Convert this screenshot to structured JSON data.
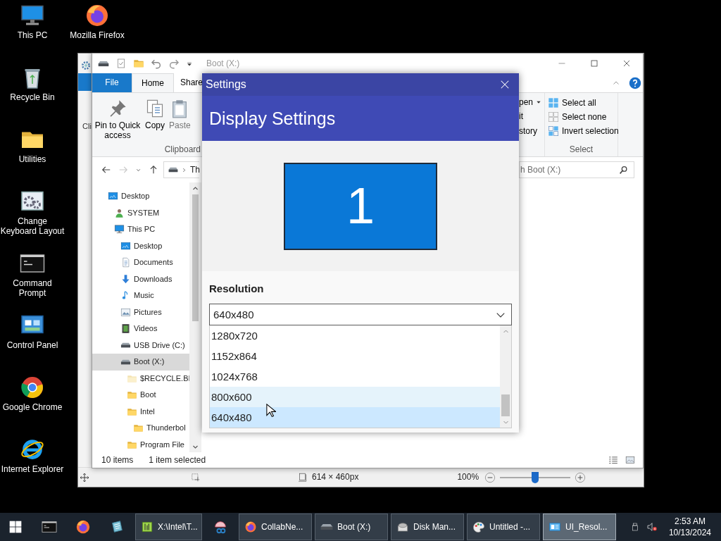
{
  "desktop_icon_columns": [
    [
      {
        "label": "This PC"
      },
      {
        "label": "Recycle Bin"
      },
      {
        "label": "Utilities"
      },
      {
        "label": "Change Keyboard Layout"
      },
      {
        "label": "Command Prompt"
      },
      {
        "label": "Control Panel"
      },
      {
        "label": "Google Chrome"
      },
      {
        "label": "Internet Explorer"
      }
    ],
    [
      {
        "label": "Mozilla Firefox"
      }
    ]
  ],
  "background_window": {
    "ribbon_fragment": "Cli",
    "status_bar": {
      "image_size": "614 × 460px",
      "zoom": "100%",
      "zoom_slider": {
        "level": 0.5
      }
    }
  },
  "explorer": {
    "title": "Boot (X:)",
    "ribbon_tabs": [
      {
        "label": "File",
        "selected": false
      },
      {
        "label": "Home",
        "selected": true
      },
      {
        "label": "Share",
        "selected": false
      }
    ],
    "clipboard": {
      "buttons": [
        "Pin to Quick access",
        "Copy",
        "Paste"
      ],
      "group": "Clipboard"
    },
    "open_fragments": [
      "pen",
      "it",
      "story"
    ],
    "select": {
      "buttons": [
        "Select all",
        "Select none",
        "Invert selection"
      ],
      "group": "Select"
    },
    "address": "Th",
    "search": {
      "placeholder": "h Boot (X:)"
    },
    "tree": [
      {
        "label": "Desktop",
        "kind": "desktop",
        "selected": false,
        "children": [
          {
            "label": "SYSTEM",
            "kind": "user",
            "selected": false
          },
          {
            "label": "This PC",
            "kind": "pc",
            "selected": false,
            "children": [
              {
                "label": "Desktop",
                "kind": "desktop",
                "selected": false
              },
              {
                "label": "Documents",
                "kind": "documents",
                "selected": false
              },
              {
                "label": "Downloads",
                "kind": "downloads",
                "selected": false
              },
              {
                "label": "Music",
                "kind": "music",
                "selected": false
              },
              {
                "label": "Pictures",
                "kind": "pictures",
                "selected": false
              },
              {
                "label": "Videos",
                "kind": "videos",
                "selected": false
              },
              {
                "label": "USB Drive (C:)",
                "kind": "drive",
                "selected": false
              },
              {
                "label": "Boot (X:)",
                "kind": "drive",
                "selected": true,
                "children": [
                  {
                    "label": "$RECYCLE.BI",
                    "kind": "hiddenfolder",
                    "selected": false
                  },
                  {
                    "label": "Boot",
                    "kind": "folder",
                    "selected": false
                  },
                  {
                    "label": "Intel",
                    "kind": "folder",
                    "selected": false,
                    "children": [
                      {
                        "label": "Thunderbol",
                        "kind": "folder",
                        "selected": false
                      }
                    ]
                  },
                  {
                    "label": "Program File",
                    "kind": "folder",
                    "selected": false
                  }
                ]
              }
            ]
          }
        ]
      }
    ],
    "status_bar": {
      "count": "10 items",
      "selection": "1 item selected"
    }
  },
  "settings": {
    "title": "Settings",
    "heading": "Display Settings",
    "monitor": "1",
    "resolution_label": "Resolution",
    "resolution": {
      "value": "640x480",
      "expanded": true,
      "options": [
        {
          "label": "1280x720",
          "selected": false,
          "hovered": false
        },
        {
          "label": "1152x864",
          "selected": false,
          "hovered": false
        },
        {
          "label": "1024x768",
          "selected": false,
          "hovered": false
        },
        {
          "label": "800x600",
          "selected": false,
          "hovered": true
        },
        {
          "label": "640x480",
          "selected": true,
          "hovered": false
        }
      ]
    }
  },
  "taskbar": {
    "buttons": [
      {
        "label": "X:\\Intel\\T...",
        "selected": false
      },
      {
        "label": "CollabNe...",
        "selected": false
      },
      {
        "label": "Boot (X:)",
        "selected": false
      },
      {
        "label": "Disk Man...",
        "selected": false
      },
      {
        "label": "Untitled -...",
        "selected": false
      },
      {
        "label": "UI_Resol...",
        "selected": true
      }
    ],
    "clock": {
      "time": "2:53 AM",
      "date": "10/13/2024"
    }
  }
}
